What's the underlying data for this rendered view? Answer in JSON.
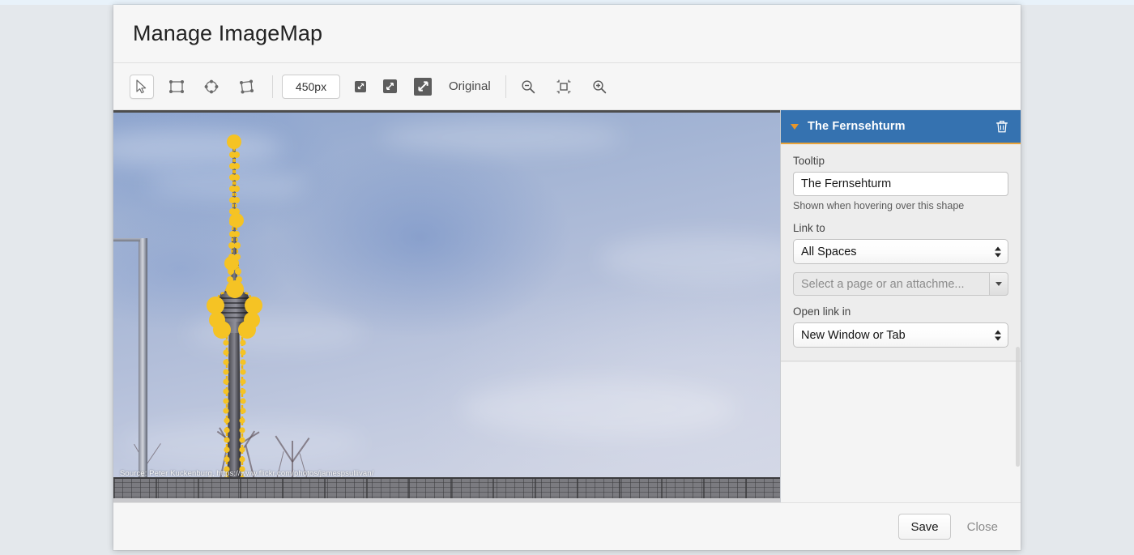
{
  "dialog": {
    "title": "Manage ImageMap"
  },
  "toolbar": {
    "tools": [
      {
        "name": "select-tool",
        "icon": "cursor-arrow-icon",
        "active": true
      },
      {
        "name": "rectangle-tool",
        "icon": "rectangle-shape-icon",
        "active": false
      },
      {
        "name": "circle-tool",
        "icon": "circle-shape-icon",
        "active": false
      },
      {
        "name": "polygon-tool",
        "icon": "polygon-shape-icon",
        "active": false
      }
    ],
    "size_value": "450px",
    "size_placeholder": "450px",
    "scale_buttons": [
      {
        "name": "scale-small-button",
        "icon": "resize-small-icon"
      },
      {
        "name": "scale-medium-button",
        "icon": "resize-medium-icon"
      },
      {
        "name": "scale-large-button",
        "icon": "resize-large-icon"
      }
    ],
    "original_label": "Original",
    "zoom_buttons": [
      {
        "name": "zoom-out-button",
        "icon": "magnifier-minus-icon"
      },
      {
        "name": "zoom-fit-button",
        "icon": "fit-to-screen-icon"
      },
      {
        "name": "zoom-in-button",
        "icon": "magnifier-plus-icon"
      }
    ]
  },
  "canvas": {
    "image_caption": "Source: Peter Kuckenburg, https://www.flickr.com/photos/jamespsullivan/",
    "shape_color": "#f5c324",
    "shape_stroke": "#e3a400"
  },
  "panel": {
    "shape_title": "The Fernsehturm",
    "delete_icon": "trash-icon",
    "collapse_icon": "caret-down-icon",
    "tooltip_label": "Tooltip",
    "tooltip_value": "The Fernsehturm",
    "tooltip_helper": "Shown when hovering over this shape",
    "link_to_label": "Link to",
    "link_to_value": "All Spaces",
    "page_picker_placeholder": "Select a page or an attachme...",
    "page_picker_value": "",
    "open_link_label": "Open link in",
    "open_link_value": "New Window or Tab",
    "header_color": "#3572b0",
    "accent_color": "#e9a33a"
  },
  "footer": {
    "save_label": "Save",
    "close_label": "Close"
  }
}
